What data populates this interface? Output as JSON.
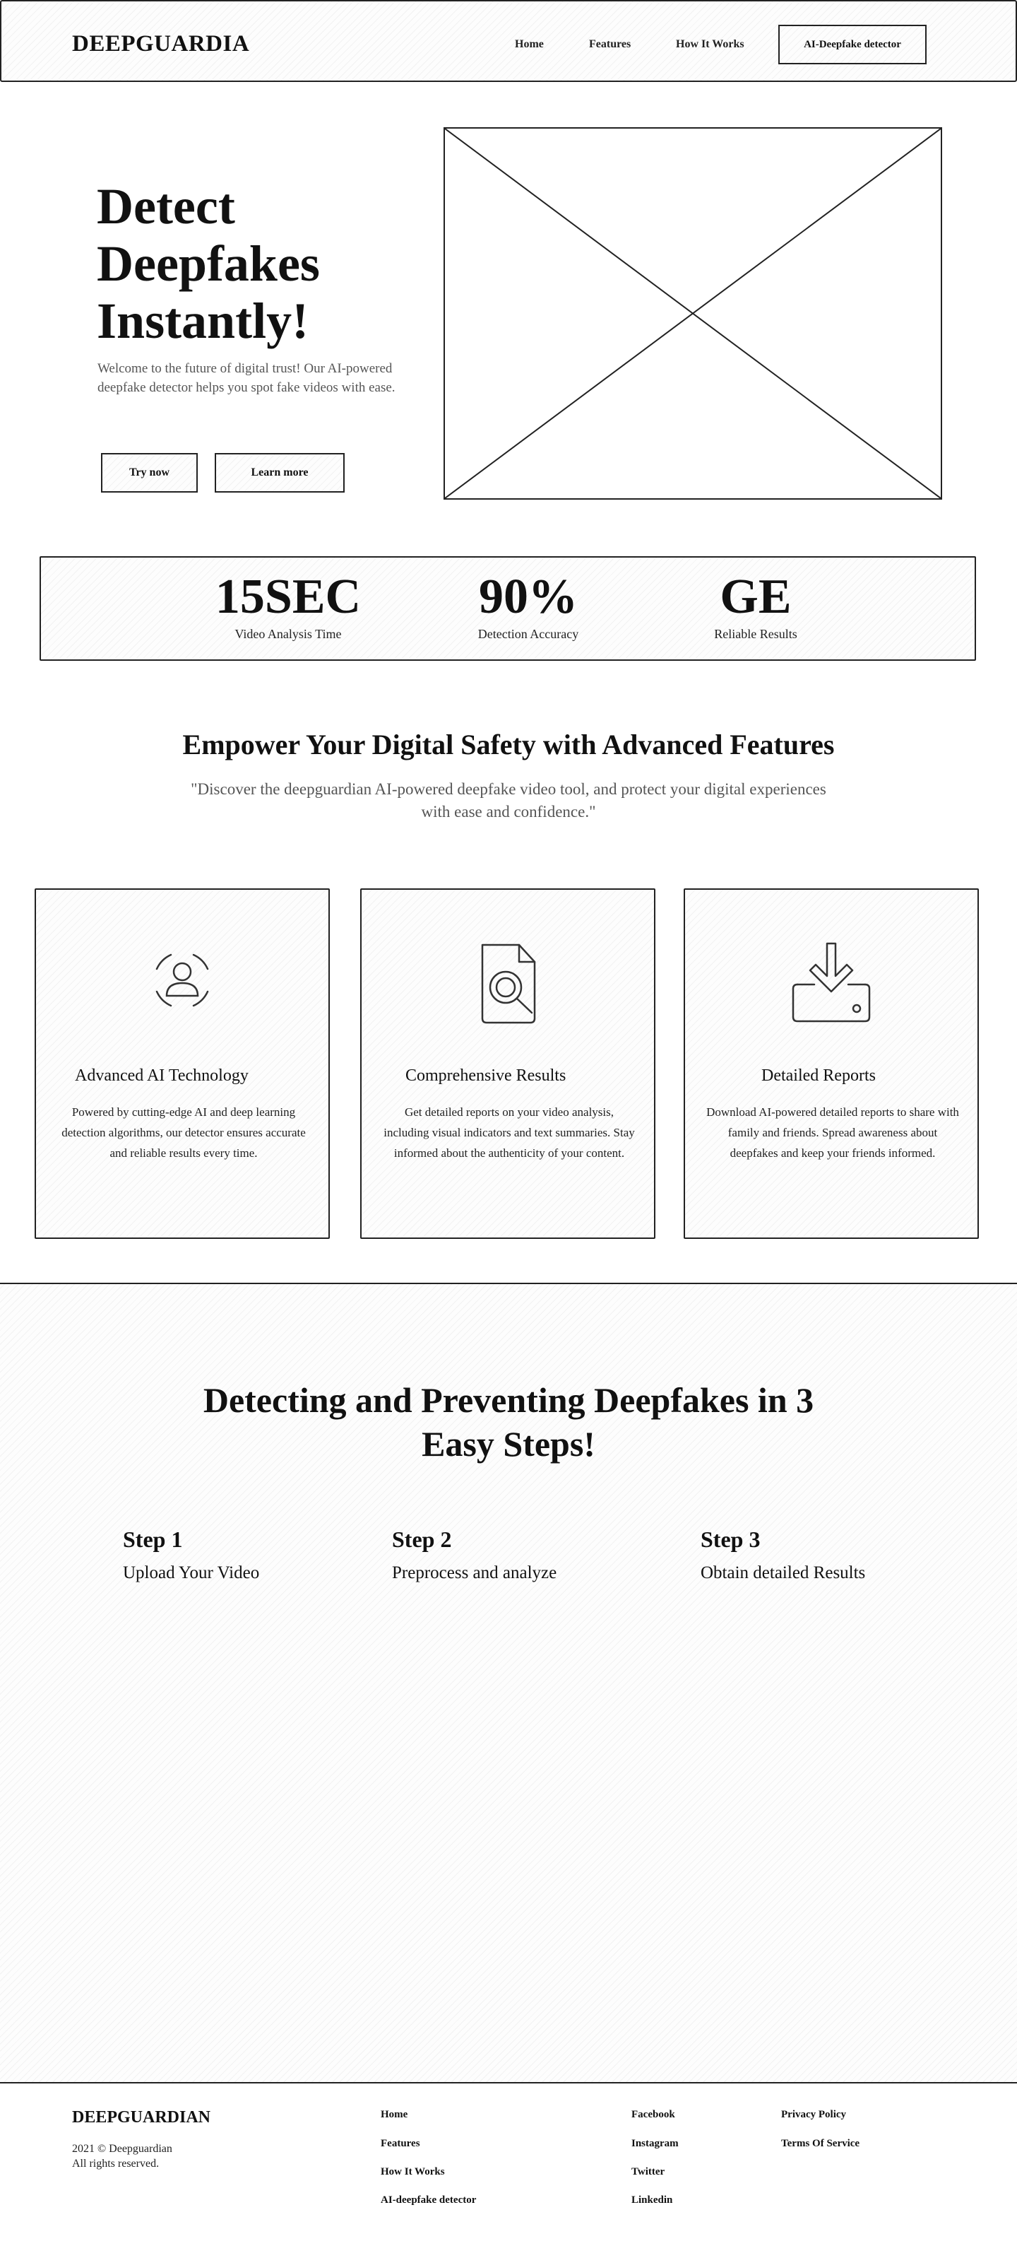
{
  "nav": {
    "logo": "DEEPGUARDIA",
    "links": [
      "Home",
      "Features",
      "How It Works"
    ],
    "cta": "AI-Deepfake detector"
  },
  "hero": {
    "title": "Detect Deepfakes Instantly!",
    "text": "Welcome to the future of digital trust! Our AI-powered deepfake detector helps you spot fake videos with ease.",
    "primary_button": "Try now",
    "secondary_button": "Learn more",
    "image_icon": "image-placeholder-icon"
  },
  "stats": [
    {
      "value": "15SEC",
      "label": "Video Analysis Time"
    },
    {
      "value": "90%",
      "label": "Detection Accuracy"
    },
    {
      "value": "GE",
      "label": "Reliable Results"
    }
  ],
  "features": {
    "title": "Empower Your Digital Safety with Advanced Features",
    "subtitle": "\"Discover the deepguardian AI-powered deepfake video tool, and protect your digital experiences with ease and confidence.\"",
    "cards": [
      {
        "icon": "ai-user-scan-icon",
        "title": "Advanced AI Technology",
        "text": "Powered by cutting-edge AI and deep learning detection algorithms, our detector ensures accurate and reliable results every time."
      },
      {
        "icon": "document-search-icon",
        "title": "Comprehensive Results",
        "text": "Get detailed reports on your video analysis, including visual indicators and text summaries. Stay informed about the authenticity of your content."
      },
      {
        "icon": "download-icon",
        "title": "Detailed Reports",
        "text": "Download AI-powered detailed reports to share with family and friends. Spread awareness about deepfakes and keep your friends informed."
      }
    ]
  },
  "steps": {
    "title": "Detecting and Preventing Deepfakes in 3 Easy Steps!",
    "items": [
      {
        "label": "Step 1",
        "text": "Upload Your Video"
      },
      {
        "label": "Step 2",
        "text": "Preprocess and analyze"
      },
      {
        "label": "Step 3",
        "text": "Obtain detailed Results"
      }
    ]
  },
  "footer": {
    "logo": "DEEPGUARDIAN",
    "copyright_line1": "2021 © Deepguardian",
    "copyright_line2": "All rights reserved.",
    "nav_links": [
      "Home",
      "Features",
      "How It Works",
      "AI-deepfake detector"
    ],
    "social_links": [
      "Facebook",
      "Instagram",
      "Twitter",
      "Linkedin"
    ],
    "legal_links": [
      "Privacy Policy",
      "Terms Of Service"
    ]
  }
}
